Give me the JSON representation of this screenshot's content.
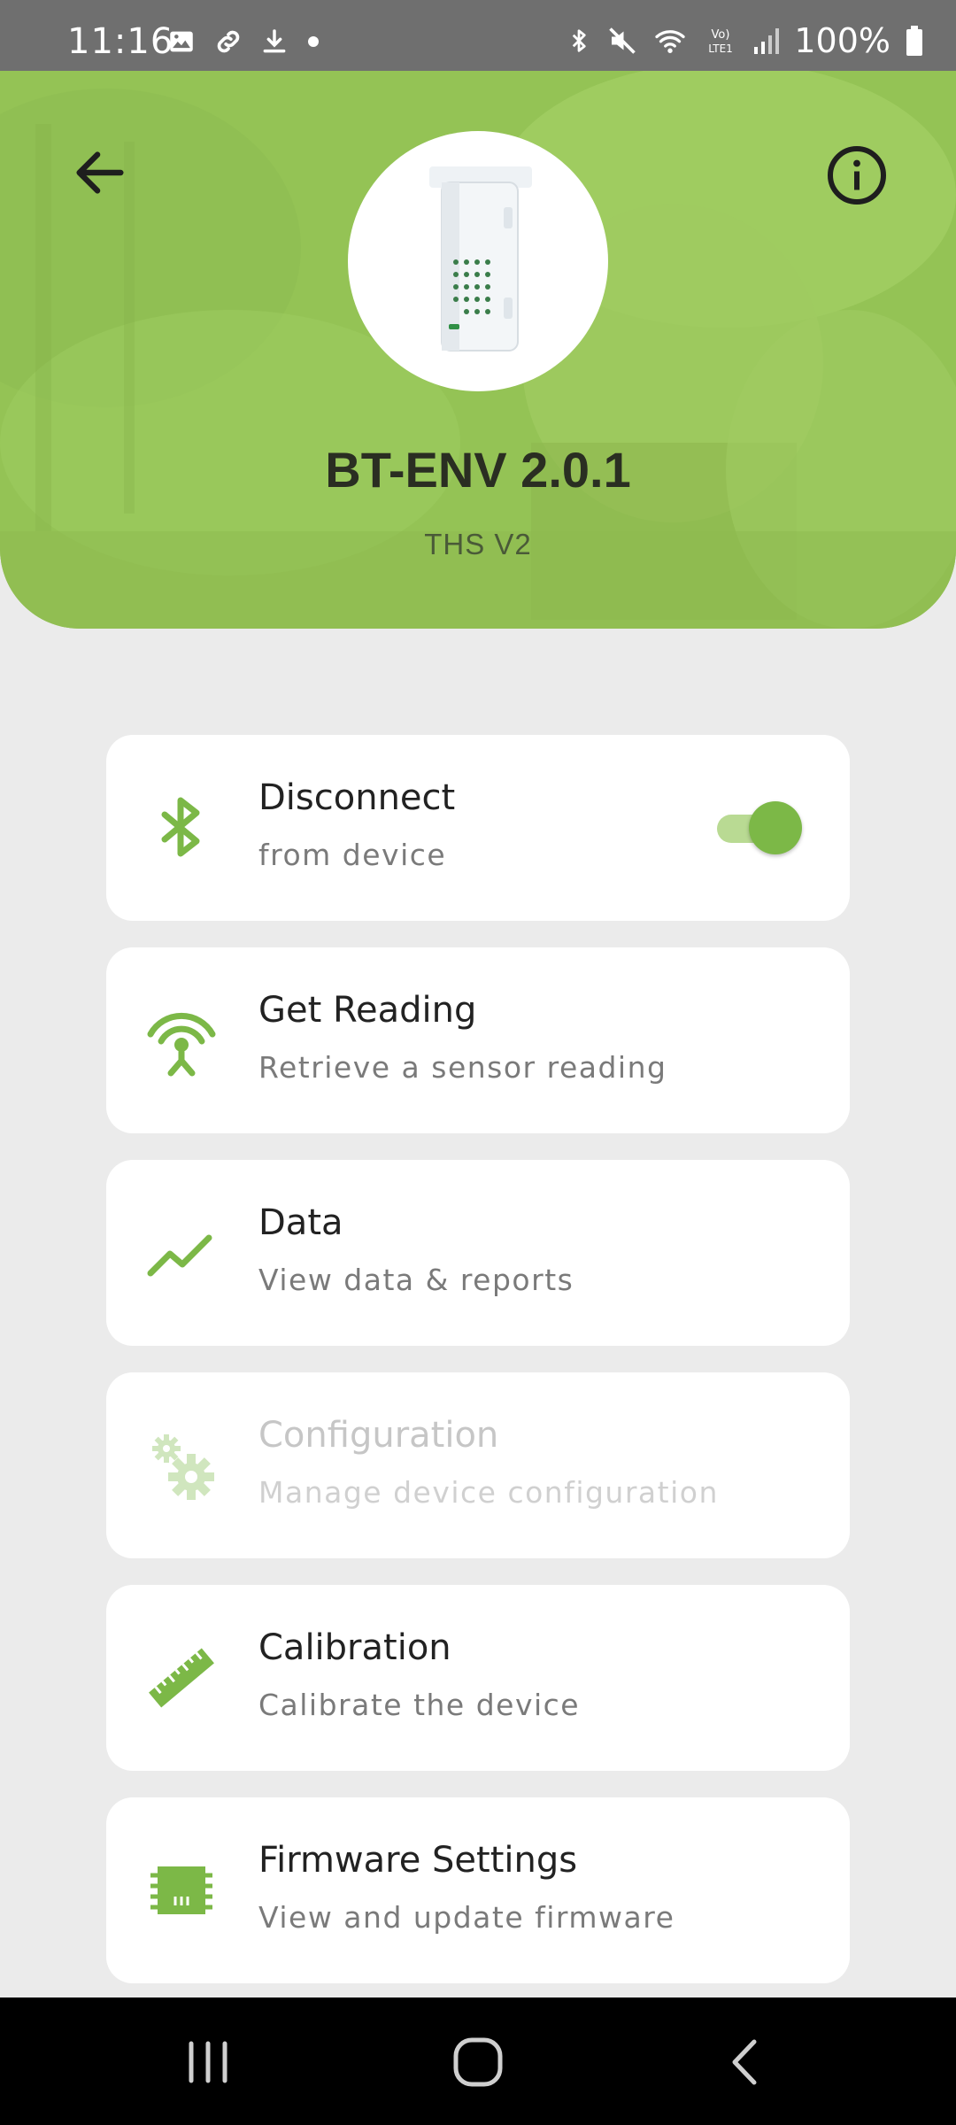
{
  "status_bar": {
    "time": "11:16",
    "battery_text": "100%"
  },
  "header": {
    "device_name": "BT-ENV 2.0.1",
    "device_model": "THS V2"
  },
  "menu": {
    "items": [
      {
        "title": "Disconnect",
        "subtitle": "from device",
        "icon": "bluetooth-icon",
        "toggle_on": true
      },
      {
        "title": "Get Reading",
        "subtitle": "Retrieve a sensor reading",
        "icon": "antenna-icon"
      },
      {
        "title": "Data",
        "subtitle": "View data & reports",
        "icon": "trend-line-icon"
      },
      {
        "title": "Configuration",
        "subtitle": "Manage device configuration",
        "icon": "gears-icon",
        "disabled": true
      },
      {
        "title": "Calibration",
        "subtitle": "Calibrate the device",
        "icon": "ruler-icon"
      },
      {
        "title": "Firmware Settings",
        "subtitle": "View and update firmware",
        "icon": "chip-icon"
      }
    ]
  },
  "colors": {
    "accent": "#7cb847",
    "header_green": "#96c457",
    "background": "#ebebeb"
  }
}
